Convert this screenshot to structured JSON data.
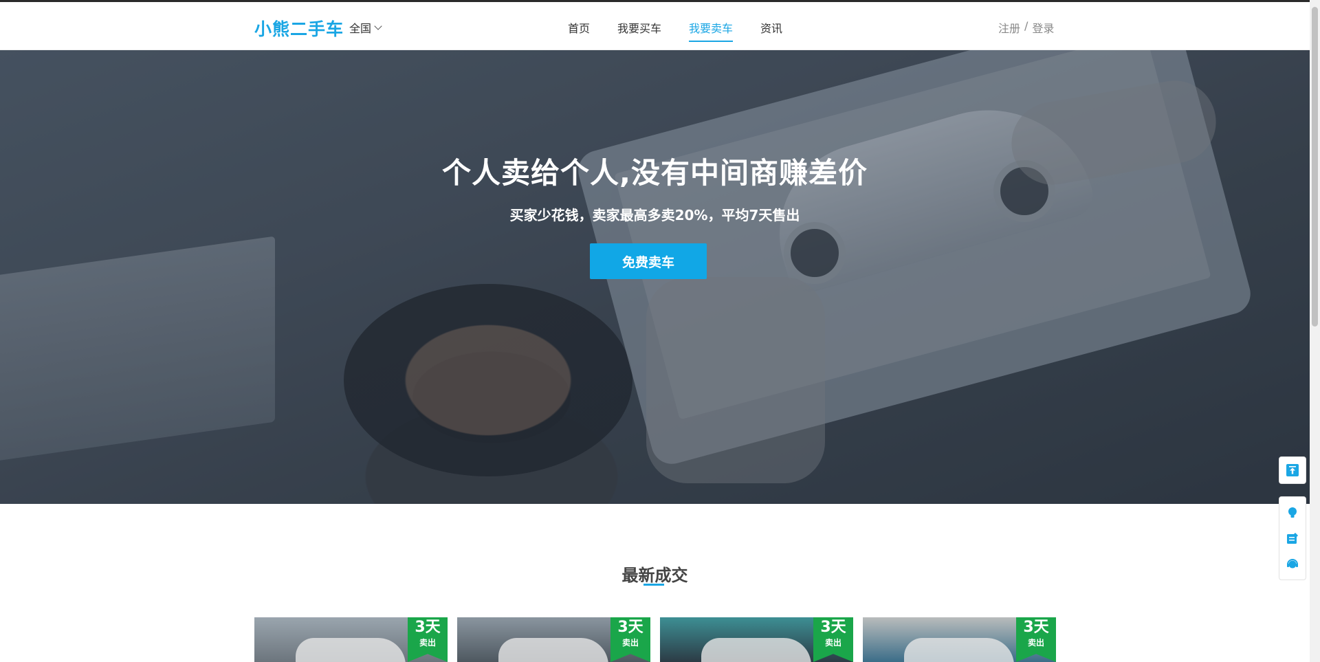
{
  "header": {
    "logo": "小熊二手车",
    "city": "全国",
    "nav": [
      "首页",
      "我要买车",
      "我要卖车",
      "资讯"
    ],
    "active_nav": "我要卖车",
    "auth": {
      "register": "注册",
      "separator": "/",
      "login": "登录"
    }
  },
  "hero": {
    "title": "个人卖给个人,没有中间商赚差价",
    "subtitle": "买家少花钱，卖家最高多卖20%，平均7天售出",
    "button": "免费卖车"
  },
  "section": {
    "title": "最新成交"
  },
  "cards": [
    {
      "days": "3天",
      "label": "卖出"
    },
    {
      "days": "3天",
      "label": "卖出"
    },
    {
      "days": "3天",
      "label": "卖出"
    },
    {
      "days": "3天",
      "label": "卖出"
    }
  ],
  "colors": {
    "accent": "#1aa6e4",
    "badge": "#1aa64a"
  },
  "side_icons": [
    "back-to-top-icon",
    "lightbulb-icon",
    "edit-note-icon",
    "customer-service-icon"
  ]
}
